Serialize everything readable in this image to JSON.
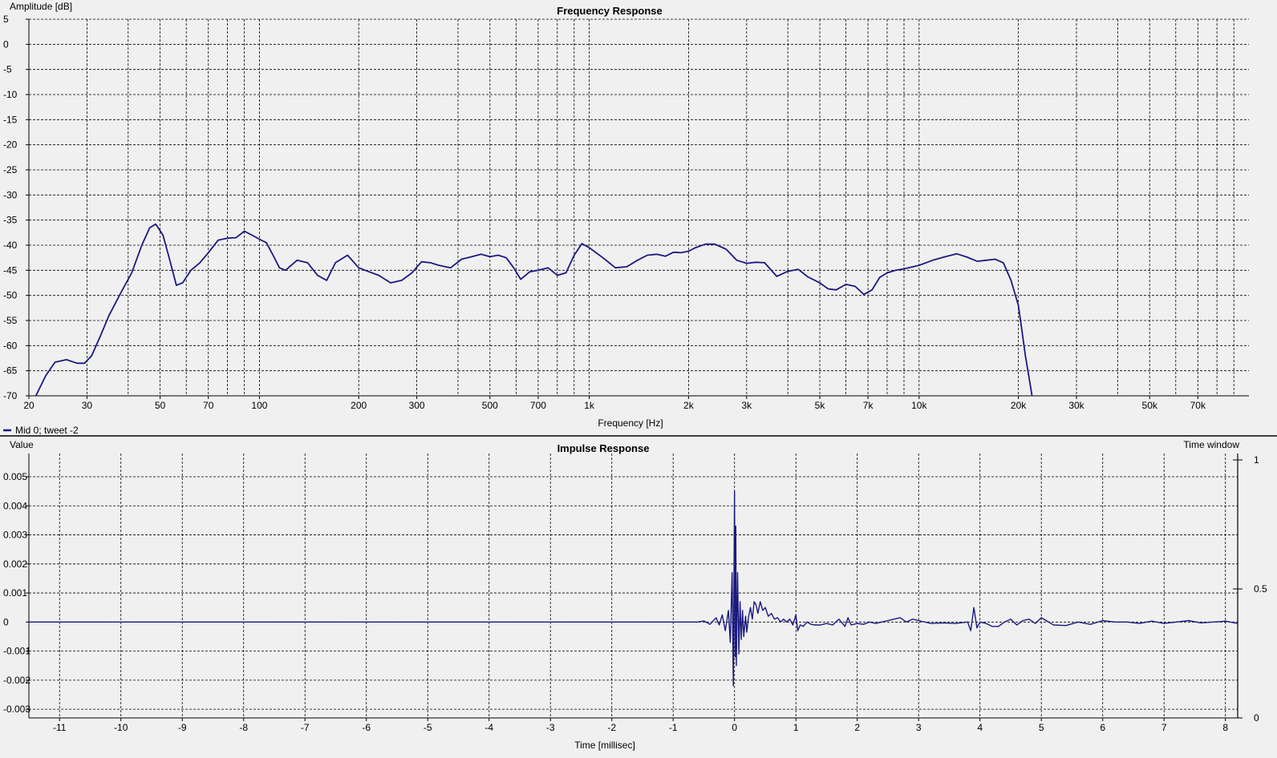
{
  "colors": {
    "series": "#1a1a80",
    "background": "#f0f0f0",
    "grid": "#000000"
  },
  "chart_data": [
    {
      "type": "line",
      "title": "Frequency Response",
      "xlabel": "Frequency [Hz]",
      "ylabel": "Amplitude [dB]",
      "xscale": "log",
      "xlim": [
        20,
        100000
      ],
      "ylim": [
        -70,
        5
      ],
      "grid": true,
      "x_tick_labels": [
        {
          "v": 20,
          "label": "20"
        },
        {
          "v": 30,
          "label": "30"
        },
        {
          "v": 50,
          "label": "50"
        },
        {
          "v": 70,
          "label": "70"
        },
        {
          "v": 100,
          "label": "100"
        },
        {
          "v": 200,
          "label": "200"
        },
        {
          "v": 300,
          "label": "300"
        },
        {
          "v": 500,
          "label": "500"
        },
        {
          "v": 700,
          "label": "700"
        },
        {
          "v": 1000,
          "label": "1k"
        },
        {
          "v": 2000,
          "label": "2k"
        },
        {
          "v": 3000,
          "label": "3k"
        },
        {
          "v": 5000,
          "label": "5k"
        },
        {
          "v": 7000,
          "label": "7k"
        },
        {
          "v": 10000,
          "label": "10k"
        },
        {
          "v": 20000,
          "label": "20k"
        },
        {
          "v": 30000,
          "label": "30k"
        },
        {
          "v": 50000,
          "label": "50k"
        },
        {
          "v": 70000,
          "label": "70k"
        }
      ],
      "y_ticks": [
        5,
        0,
        -5,
        -10,
        -15,
        -20,
        -25,
        -30,
        -35,
        -40,
        -45,
        -50,
        -55,
        -60,
        -65,
        -70
      ],
      "series": [
        {
          "name": "Mid 0; tweet -2",
          "x": [
            21,
            22.5,
            24,
            26,
            28,
            29.5,
            31,
            33,
            35,
            38,
            41,
            44,
            46.5,
            48.5,
            51,
            53.5,
            56,
            58.5,
            62,
            66,
            70,
            75,
            80,
            85,
            90,
            95,
            100,
            105,
            110,
            115,
            120,
            130,
            140,
            150,
            160,
            170,
            185,
            200,
            215,
            230,
            250,
            270,
            290,
            310,
            330,
            350,
            380,
            410,
            440,
            470,
            500,
            530,
            560,
            590,
            620,
            660,
            700,
            750,
            800,
            850,
            900,
            950,
            1000,
            1100,
            1200,
            1300,
            1400,
            1500,
            1600,
            1700,
            1800,
            1900,
            2000,
            2100,
            2250,
            2400,
            2600,
            2800,
            3000,
            3200,
            3400,
            3700,
            4000,
            4300,
            4600,
            5000,
            5300,
            5600,
            6000,
            6400,
            6800,
            7200,
            7600,
            8000,
            8500,
            9000,
            10000,
            11000,
            12000,
            13000,
            14000,
            15000,
            16000,
            17000,
            18000,
            19000,
            20000,
            20500,
            21000,
            21500,
            22000
          ],
          "y": [
            -70,
            -66,
            -63.3,
            -62.8,
            -63.5,
            -63.5,
            -62,
            -58,
            -54,
            -49.5,
            -45.5,
            -40,
            -36.5,
            -35.8,
            -38,
            -43,
            -48,
            -47.5,
            -45,
            -43.5,
            -41.5,
            -39,
            -38.6,
            -38.5,
            -37.2,
            -38,
            -38.8,
            -39.5,
            -42,
            -44.5,
            -45,
            -43,
            -43.5,
            -46,
            -47,
            -43.5,
            -42,
            -44.5,
            -45.3,
            -46,
            -47.5,
            -47,
            -45.5,
            -43.3,
            -43.5,
            -44,
            -44.5,
            -42.8,
            -42.3,
            -41.8,
            -42.3,
            -42,
            -42.5,
            -44.5,
            -46.8,
            -45.3,
            -45,
            -44.5,
            -46,
            -45.5,
            -42,
            -39.7,
            -40.5,
            -42.5,
            -44.5,
            -44.3,
            -43,
            -42,
            -41.8,
            -42.2,
            -41.4,
            -41.5,
            -41.2,
            -40.5,
            -39.8,
            -39.8,
            -40.8,
            -43,
            -43.6,
            -43.4,
            -43.5,
            -46.2,
            -45.2,
            -44.8,
            -46.3,
            -47.5,
            -48.7,
            -48.9,
            -47.8,
            -48.2,
            -49.8,
            -48.9,
            -46.4,
            -45.5,
            -45,
            -44.7,
            -44,
            -43,
            -42.3,
            -41.7,
            -42.4,
            -43.2,
            -43,
            -42.8,
            -43.5,
            -47,
            -52,
            -57,
            -62,
            -66,
            -70
          ]
        }
      ]
    },
    {
      "type": "line",
      "title": "Impulse Response",
      "xlabel": "Time [millisec]",
      "ylabel": "Value",
      "y2label": "Time window",
      "xlim": [
        -11.5,
        8.2
      ],
      "ylim": [
        -0.0033,
        0.0058
      ],
      "y2lim": [
        0,
        1
      ],
      "grid": true,
      "x_ticks": [
        -11,
        -10,
        -9,
        -8,
        -7,
        -6,
        -5,
        -4,
        -3,
        -2,
        -1,
        0,
        1,
        2,
        3,
        4,
        5,
        6,
        7,
        8
      ],
      "y_tick_labels": [
        {
          "v": 0.005,
          "label": "0.005"
        },
        {
          "v": 0.004,
          "label": "0.004"
        },
        {
          "v": 0.003,
          "label": "0.003"
        },
        {
          "v": 0.002,
          "label": "0.002"
        },
        {
          "v": 0.001,
          "label": "0.001"
        },
        {
          "v": 0,
          "label": "0"
        },
        {
          "v": -0.001,
          "label": "-0.001"
        },
        {
          "v": -0.002,
          "label": "-0.002"
        },
        {
          "v": -0.003,
          "label": "-0.003"
        }
      ],
      "y2_tick_labels": [
        {
          "v": 1,
          "label": "1"
        },
        {
          "v": 0.5,
          "label": "0.5"
        },
        {
          "v": 0,
          "label": "0"
        }
      ],
      "series": [
        {
          "name": "Mid 0; tweet -2",
          "x": [
            -11.5,
            -0.6,
            -0.5,
            -0.4,
            -0.3,
            -0.25,
            -0.2,
            -0.15,
            -0.1,
            -0.07,
            -0.04,
            -0.02,
            0.0,
            0.01,
            0.02,
            0.03,
            0.05,
            0.07,
            0.09,
            0.11,
            0.13,
            0.15,
            0.18,
            0.2,
            0.23,
            0.26,
            0.29,
            0.32,
            0.35,
            0.38,
            0.42,
            0.46,
            0.5,
            0.55,
            0.6,
            0.65,
            0.7,
            0.75,
            0.8,
            0.85,
            0.9,
            0.95,
            1.0,
            1.03,
            1.07,
            1.12,
            1.18,
            1.25,
            1.32,
            1.4,
            1.5,
            1.6,
            1.7,
            1.8,
            1.85,
            1.9,
            2.0,
            2.1,
            2.2,
            2.3,
            2.4,
            2.5,
            2.6,
            2.7,
            2.8,
            2.9,
            3.0,
            3.2,
            3.4,
            3.6,
            3.8,
            3.85,
            3.9,
            3.95,
            4.0,
            4.1,
            4.2,
            4.3,
            4.4,
            4.5,
            4.6,
            4.7,
            4.8,
            4.9,
            5.0,
            5.2,
            5.4,
            5.6,
            5.8,
            6.0,
            6.2,
            6.4,
            6.6,
            6.8,
            7.0,
            7.2,
            7.4,
            7.6,
            7.8,
            8.0,
            8.2
          ],
          "y": [
            0,
            0,
            4e-05,
            -8e-05,
            0.00015,
            -0.0001,
            0.00025,
            -0.0003,
            0.0004,
            -0.0007,
            0.0017,
            -0.0022,
            0.0045,
            -0.0012,
            0.0033,
            -0.0015,
            0.0017,
            -0.0011,
            0.0007,
            -0.0006,
            0.0004,
            -0.0005,
            0.0002,
            -0.00035,
            0.0002,
            0.0005,
            0.0001,
            0.0007,
            0.0006,
            0.0003,
            0.0007,
            0.0004,
            0.0005,
            0.0002,
            0.0003,
            0.0001,
            0.00015,
            0.0,
            0.0001,
            0.0,
            0.0001,
            -0.0001,
            0.00025,
            -0.0003,
            -0.0001,
            -0.00015,
            0.0,
            -8e-05,
            -0.0001,
            -0.0001,
            -5e-05,
            -0.0001,
            0.0001,
            -0.00015,
            0.00015,
            -0.0001,
            -5e-05,
            -8e-05,
            0.0,
            -5e-05,
            0.0,
            5e-05,
            0.0001,
            0.00015,
            0.0,
            0.0001,
            5e-05,
            -5e-05,
            -3e-05,
            -5e-05,
            0.0,
            -0.0003,
            0.0005,
            -0.0002,
            0.0,
            -5e-05,
            -0.00015,
            -0.00015,
            0.0,
            0.0001,
            -0.0001,
            5e-05,
            0.0001,
            -5e-05,
            0.00015,
            -0.0001,
            -0.00012,
            0.0,
            -8e-05,
            5e-05,
            0.0,
            0.0,
            -5e-05,
            3e-05,
            -5e-05,
            0.0,
            5e-05,
            -3e-05,
            0.0,
            3e-05,
            -5e-05
          ]
        }
      ]
    }
  ]
}
